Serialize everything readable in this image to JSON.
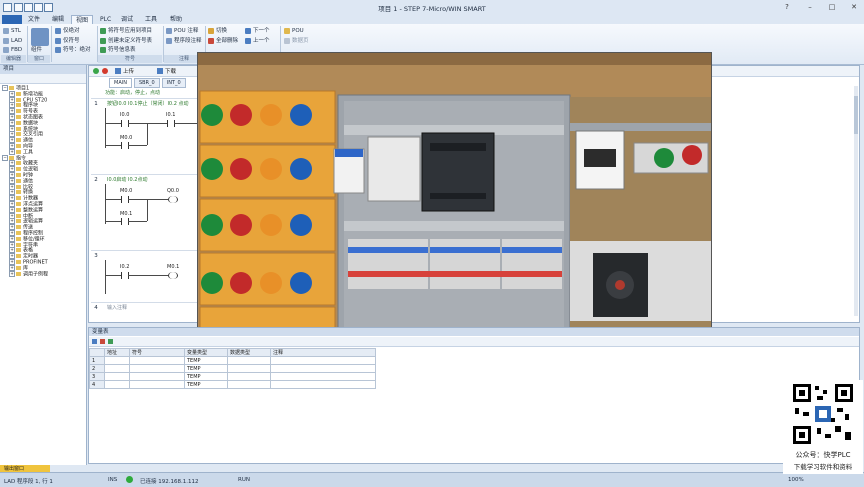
{
  "window": {
    "title": "项目 1 - STEP 7-Micro/WIN SMART"
  },
  "menu": [
    "文件",
    "编辑",
    "视图",
    "PLC",
    "调试",
    "工具",
    "帮助"
  ],
  "menu_active": "视图",
  "ribbon": {
    "view_modes": [
      "STL",
      "LAD",
      "FBD"
    ],
    "component_label": "组件",
    "address": [
      "仅绝对",
      "仅符号",
      "符号：绝对"
    ],
    "symbol": [
      "将符号应用到项目",
      "创建未定义符号表",
      "符号信息表"
    ],
    "pou": [
      "POU 注释",
      "程序段注释"
    ],
    "bookmark": [
      "切换",
      "全部删除"
    ],
    "nav": [
      "下一个",
      "上一个"
    ],
    "pou_view": [
      "POU",
      "数据页"
    ],
    "groups": [
      "编辑器",
      "窗口",
      "符号",
      "注释",
      "书签",
      "属性"
    ]
  },
  "tree": {
    "header": "项目",
    "items": [
      {
        "label": "项目1",
        "depth": 0,
        "open": true
      },
      {
        "label": "新增功能",
        "depth": 1
      },
      {
        "label": "CPU ST20",
        "depth": 1
      },
      {
        "label": "程序块",
        "depth": 1
      },
      {
        "label": "符号表",
        "depth": 1
      },
      {
        "label": "状态图表",
        "depth": 1
      },
      {
        "label": "数据块",
        "depth": 1
      },
      {
        "label": "系统块",
        "depth": 1
      },
      {
        "label": "交叉引用",
        "depth": 1
      },
      {
        "label": "通信",
        "depth": 1
      },
      {
        "label": "向导",
        "depth": 1
      },
      {
        "label": "工具",
        "depth": 1
      },
      {
        "label": "指令",
        "depth": 0,
        "open": true
      },
      {
        "label": "收藏夹",
        "depth": 1
      },
      {
        "label": "位逻辑",
        "depth": 1
      },
      {
        "label": "时钟",
        "depth": 1
      },
      {
        "label": "通信",
        "depth": 1
      },
      {
        "label": "比较",
        "depth": 1
      },
      {
        "label": "转换",
        "depth": 1
      },
      {
        "label": "计数器",
        "depth": 1
      },
      {
        "label": "浮点运算",
        "depth": 1
      },
      {
        "label": "整数运算",
        "depth": 1
      },
      {
        "label": "中断",
        "depth": 1
      },
      {
        "label": "逻辑运算",
        "depth": 1
      },
      {
        "label": "传送",
        "depth": 1
      },
      {
        "label": "程序控制",
        "depth": 1
      },
      {
        "label": "移位/循环",
        "depth": 1
      },
      {
        "label": "字符串",
        "depth": 1
      },
      {
        "label": "表格",
        "depth": 1
      },
      {
        "label": "定时器",
        "depth": 1
      },
      {
        "label": "PROFINET",
        "depth": 1
      },
      {
        "label": "库",
        "depth": 1
      },
      {
        "label": "调用子例程",
        "depth": 1
      }
    ]
  },
  "editor": {
    "tabs": [
      "MAIN",
      "SBR_0",
      "INT_0"
    ],
    "toolbar": [
      "上传",
      "下载"
    ],
    "pou_comment": "功能：启动，停止，点动",
    "networks": [
      {
        "num": "1",
        "comment": "按钮I0.0  I0.1停止（常闭）I0.2 点动",
        "contacts": [
          "I0.0",
          "I0.1",
          "M0.0"
        ],
        "coil": ""
      },
      {
        "num": "2",
        "comment": "I0.0启动 I0.2点动",
        "contacts": [
          "M0.0",
          "M0.1"
        ],
        "coil": "Q0.0"
      },
      {
        "num": "3",
        "comment": "",
        "contacts": [
          "I0.2"
        ],
        "coil": "M0.1"
      },
      {
        "num": "4",
        "comment": "输入注释",
        "contacts": [],
        "coil": ""
      }
    ]
  },
  "vartable": {
    "title": "变量表",
    "columns": [
      "地址",
      "符号",
      "变量类型",
      "数据类型",
      "注释"
    ],
    "rows": [
      {
        "n": "1",
        "addr": "",
        "sym": "",
        "vtype": "TEMP",
        "dtype": "",
        "cmt": ""
      },
      {
        "n": "2",
        "addr": "",
        "sym": "",
        "vtype": "TEMP",
        "dtype": "",
        "cmt": ""
      },
      {
        "n": "3",
        "addr": "",
        "sym": "",
        "vtype": "TEMP",
        "dtype": "",
        "cmt": ""
      },
      {
        "n": "4",
        "addr": "",
        "sym": "",
        "vtype": "TEMP",
        "dtype": "",
        "cmt": ""
      }
    ]
  },
  "status": {
    "output_tab": "输出窗口",
    "mode": "LAD 程序段 1, 行 1",
    "ins": "INS",
    "connection": "已连接 192.168.1.112",
    "run": "RUN",
    "zoom": "100%"
  },
  "watermark": {
    "line1": "公众号：快学PLC",
    "line2": "下载学习软件和资料"
  },
  "colors": {
    "ribbon_blue": "#2b66b4",
    "comment_green": "#2d7a2d",
    "status_green": "#2eaa3c"
  }
}
